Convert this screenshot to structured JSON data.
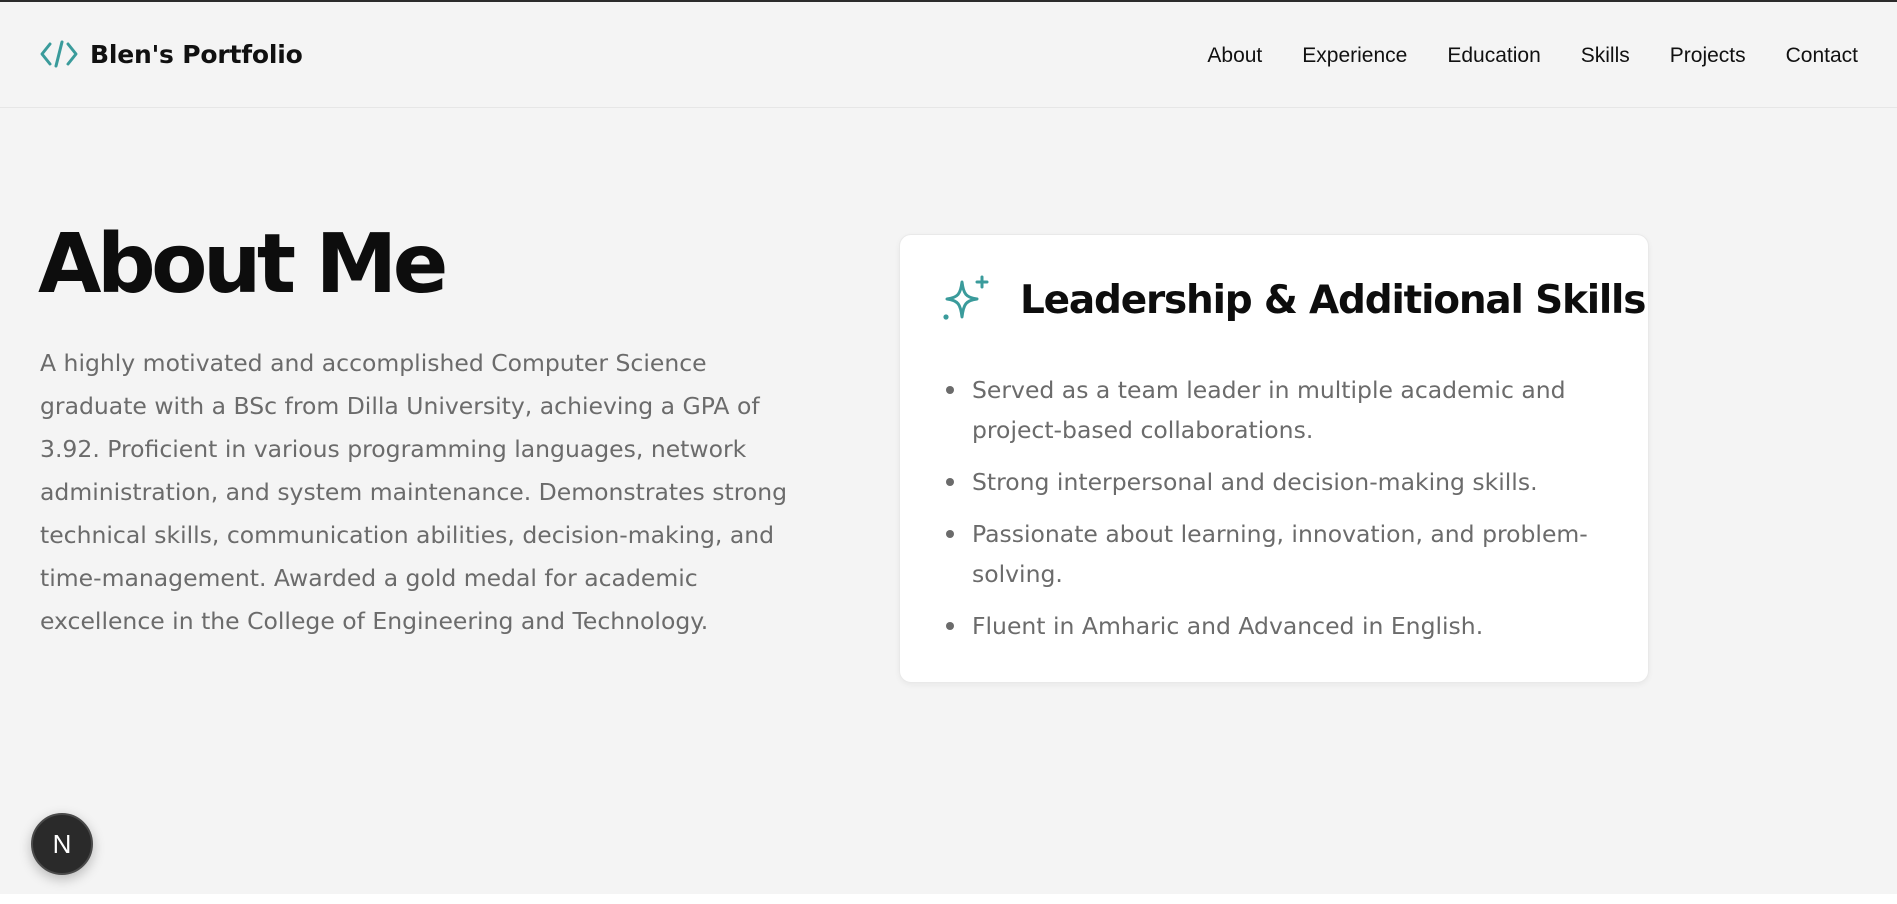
{
  "header": {
    "brand_icon": "code-brackets-icon",
    "brand_title": "Blen's Portfolio",
    "nav": [
      {
        "label": "About"
      },
      {
        "label": "Experience"
      },
      {
        "label": "Education"
      },
      {
        "label": "Skills"
      },
      {
        "label": "Projects"
      },
      {
        "label": "Contact"
      }
    ]
  },
  "about": {
    "title": "About Me",
    "text": "A highly motivated and accomplished Computer Science graduate with a BSc from Dilla University, achieving a GPA of 3.92. Proficient in various programming languages, network administration, and system maintenance. Demonstrates strong technical skills, communication abilities, decision-making, and time-management. Awarded a gold medal for academic excellence in the College of Engineering and Technology."
  },
  "card": {
    "icon": "sparkles-icon",
    "title": "Leadership & Additional Skills",
    "items": [
      "Served as a team leader in multiple academic and project-based collaborations.",
      "Strong interpersonal and decision-making skills.",
      "Passionate about learning, innovation, and problem-solving.",
      "Fluent in Amharic and Advanced in English."
    ]
  },
  "badge": {
    "letter": "N",
    "icon": "nextjs-icon"
  },
  "colors": {
    "accent": "#3a9b9b",
    "background": "#f4f4f4",
    "text_muted": "#6b6b6b",
    "heading": "#0d0d0d"
  }
}
